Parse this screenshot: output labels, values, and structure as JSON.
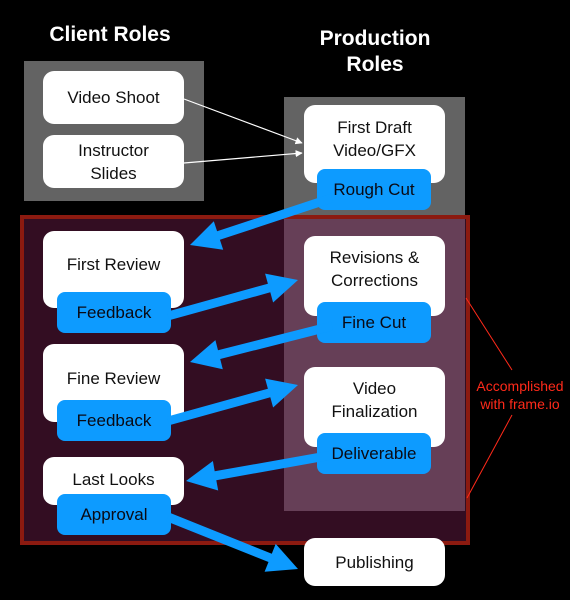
{
  "headings": {
    "client": "Client Roles",
    "production_line1": "Production",
    "production_line2": "Roles"
  },
  "client_nodes": [
    {
      "line1": "Video Shoot",
      "line2": ""
    },
    {
      "line1": "Instructor",
      "line2": "Slides"
    }
  ],
  "client_review_nodes": [
    {
      "label": "First Review",
      "tag": "Feedback"
    },
    {
      "label": "Fine Review",
      "tag": "Feedback"
    },
    {
      "label": "Last Looks",
      "tag": "Approval"
    }
  ],
  "production_nodes": [
    {
      "line1": "First Draft",
      "line2": "Video/GFX",
      "tag": "Rough Cut"
    },
    {
      "line1": "Revisions &",
      "line2": "Corrections",
      "tag": "Fine Cut"
    },
    {
      "line1": "Video",
      "line2": "Finalization",
      "tag": "Deliverable"
    }
  ],
  "final_node": {
    "label": "Publishing"
  },
  "annotation": {
    "line1": "Accomplished",
    "line2": "with frame.io"
  },
  "colors": {
    "arrow": "#0d9bff",
    "frame_border": "#8c1a10",
    "annotation": "#ff2a1a",
    "connector": "#ffffff"
  }
}
